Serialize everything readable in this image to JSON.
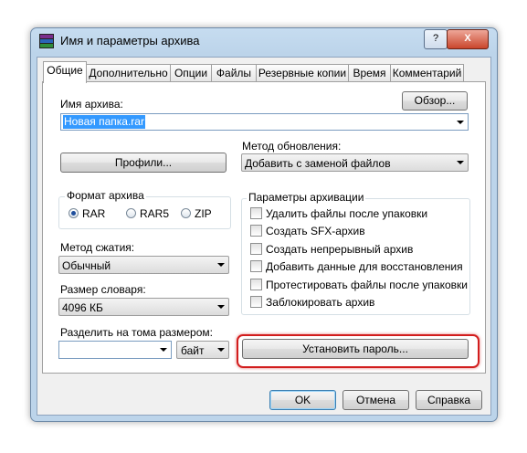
{
  "window": {
    "title": "Имя и параметры архива",
    "help_button": "?",
    "close_button": "X"
  },
  "tabs": [
    {
      "label": "Общие"
    },
    {
      "label": "Дополнительно"
    },
    {
      "label": "Опции"
    },
    {
      "label": "Файлы"
    },
    {
      "label": "Резервные копии"
    },
    {
      "label": "Время"
    },
    {
      "label": "Комментарий"
    }
  ],
  "archive_name": {
    "label": "Имя архива:",
    "value": "Новая папка.rar",
    "browse_button": "Обзор..."
  },
  "profiles_button": "Профили...",
  "update_method": {
    "label": "Метод обновления:",
    "value": "Добавить с заменой файлов"
  },
  "archive_format": {
    "label": "Формат архива",
    "options": [
      {
        "label": "RAR",
        "selected": true
      },
      {
        "label": "RAR5",
        "selected": false
      },
      {
        "label": "ZIP",
        "selected": false
      }
    ]
  },
  "compression": {
    "label": "Метод сжатия:",
    "value": "Обычный"
  },
  "dictionary": {
    "label": "Размер словаря:",
    "value": "4096 КБ"
  },
  "split": {
    "label": "Разделить на тома размером:",
    "value": "",
    "unit": "байт"
  },
  "archive_options": {
    "label": "Параметры архивации",
    "items": [
      {
        "label": "Удалить файлы после упаковки",
        "checked": false
      },
      {
        "label": "Создать SFX-архив",
        "checked": false
      },
      {
        "label": "Создать непрерывный архив",
        "checked": false
      },
      {
        "label": "Добавить данные для восстановления",
        "checked": false
      },
      {
        "label": "Протестировать файлы после упаковки",
        "checked": false
      },
      {
        "label": "Заблокировать архив",
        "checked": false
      }
    ]
  },
  "set_password_button": "Установить пароль...",
  "footer": {
    "ok": "OK",
    "cancel": "Отмена",
    "help": "Справка"
  },
  "colors": {
    "highlight_ring": "#d21d1d",
    "selection": "#3399ff",
    "radio_dot": "#1f4e9c"
  }
}
